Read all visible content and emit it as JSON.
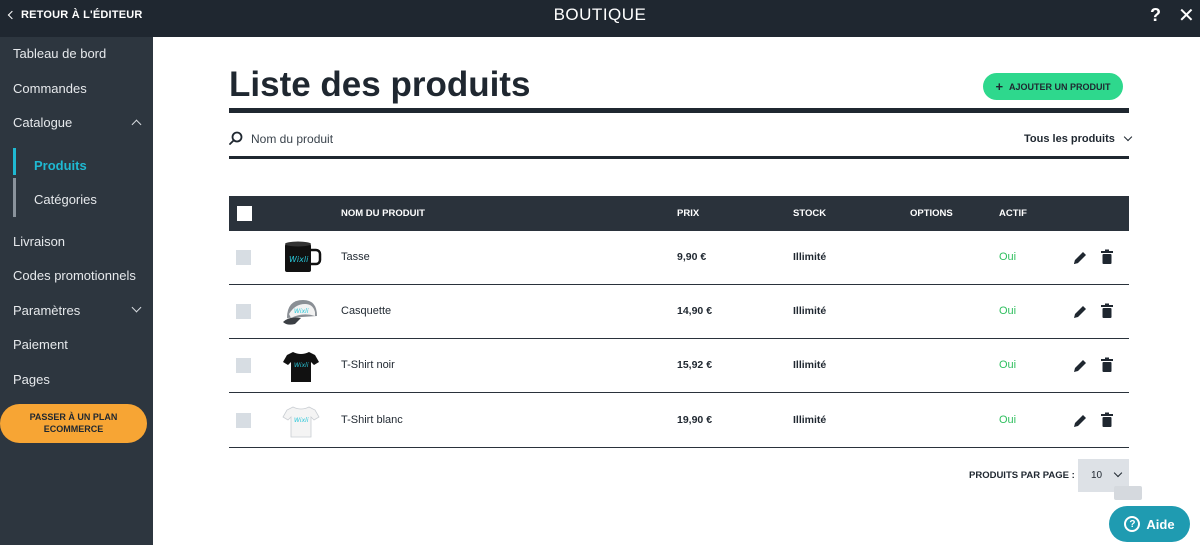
{
  "topbar": {
    "back_label": "RETOUR À L'ÉDITEUR",
    "title": "BOUTIQUE",
    "help_label": "?",
    "close_label": "✕"
  },
  "sidebar": {
    "items": [
      {
        "label": "Tableau de bord"
      },
      {
        "label": "Commandes"
      },
      {
        "label": "Catalogue",
        "expanded": true
      },
      {
        "label": "Livraison"
      },
      {
        "label": "Codes promotionnels"
      },
      {
        "label": "Paramètres",
        "expanded": false
      },
      {
        "label": "Paiement"
      },
      {
        "label": "Pages"
      }
    ],
    "catalogue_sub": [
      {
        "label": "Produits",
        "active": true
      },
      {
        "label": "Catégories",
        "active": false
      }
    ],
    "upgrade_line1": "PASSER À UN PLAN",
    "upgrade_line2": "ECOMMERCE"
  },
  "main": {
    "title": "Liste des produits",
    "add_button_label": "AJOUTER UN PRODUIT",
    "search_placeholder": "Nom du produit",
    "filter_value": "Tous les produits"
  },
  "table": {
    "headers": {
      "name": "NOM DU PRODUIT",
      "price": "PRIX",
      "stock": "STOCK",
      "options": "OPTIONS",
      "active": "ACTIF"
    },
    "rows": [
      {
        "name": "Tasse",
        "price": "9,90 €",
        "stock": "Illimité",
        "active": "Oui",
        "thumb": "mug"
      },
      {
        "name": "Casquette",
        "price": "14,90 €",
        "stock": "Illimité",
        "active": "Oui",
        "thumb": "cap"
      },
      {
        "name": "T-Shirt noir",
        "price": "15,92 €",
        "stock": "Illimité",
        "active": "Oui",
        "thumb": "tshirt-black"
      },
      {
        "name": "T-Shirt blanc",
        "price": "19,90 €",
        "stock": "Illimité",
        "active": "Oui",
        "thumb": "tshirt-white"
      }
    ]
  },
  "pagination": {
    "label": "PRODUITS PAR PAGE :",
    "value": "10"
  },
  "help_widget": {
    "label": "Aide",
    "icon": "?"
  },
  "colors": {
    "dark": "#1f2730",
    "sidebar": "#2d363f",
    "accent_cyan": "#1fb9d2",
    "add_green": "#2ed88d",
    "active_green": "#2fbf5f",
    "upgrade_orange": "#f7a534",
    "help_teal": "#1f9bb1"
  }
}
